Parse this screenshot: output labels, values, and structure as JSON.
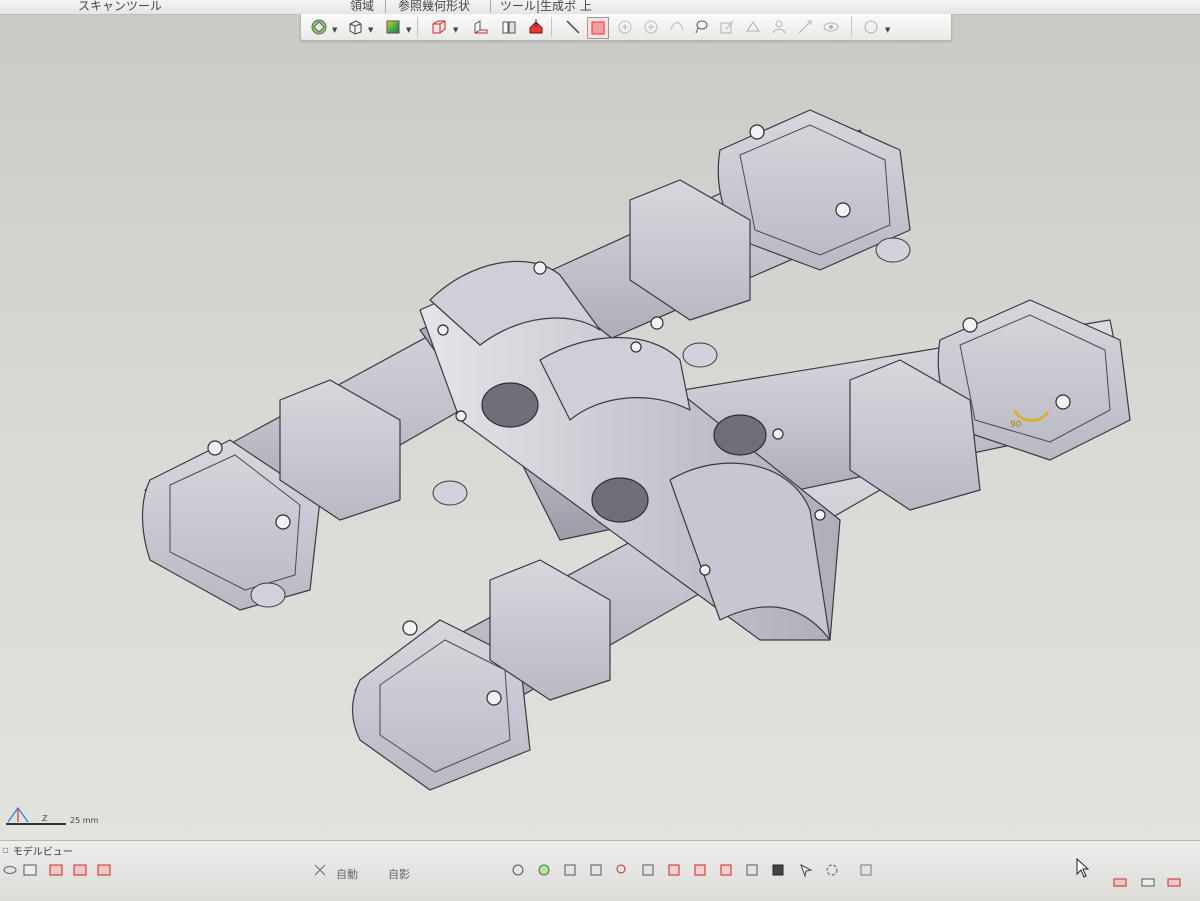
{
  "menu": {
    "scan_tools": "スキャンツール",
    "region": "領域",
    "reference_geometry": "参照幾何形状",
    "partial": "ツール|生成ボ 上"
  },
  "toolbar": {
    "icons": [
      "display-style-icon",
      "box-view-icon",
      "color-map-icon",
      "wireframe-cube-icon",
      "section-left-icon",
      "section-right-icon",
      "section-plane-icon",
      "line-tool-icon",
      "select-rect-icon",
      "add-point-icon",
      "add-point-2-icon",
      "curve-tool-icon",
      "lasso-tool-icon",
      "edit-tool-icon",
      "measure-tool-icon",
      "person-tool-icon",
      "transform-tool-icon",
      "eye-icon",
      "visibility-icon"
    ]
  },
  "viewport": {
    "model": "engine-cover-mesh",
    "angle_annotation": "90",
    "scale_bar": "25 mm",
    "axis_label": "Z"
  },
  "bottom": {
    "tab_label": "モデルビュー",
    "auto_label_1": "自動",
    "auto_label_2": "自影"
  },
  "colors": {
    "accent": "#e0b020",
    "toolbar_red": "#e53935",
    "model_fill": "#c4c4cc"
  }
}
